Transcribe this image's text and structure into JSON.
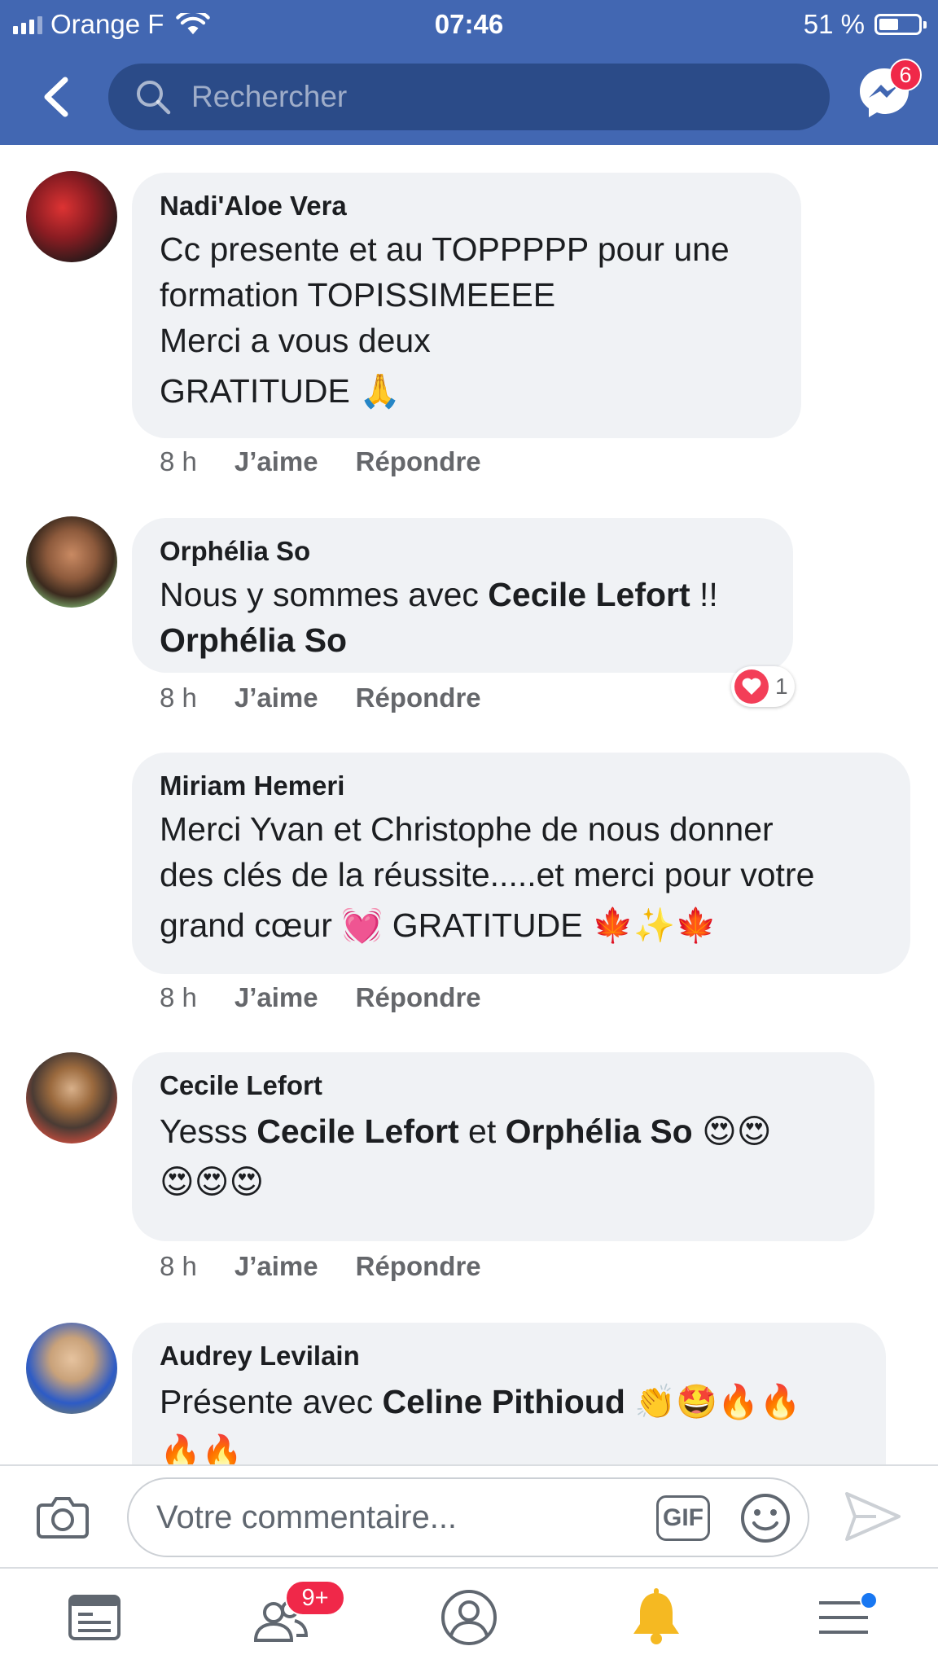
{
  "status_bar": {
    "carrier": "Orange F",
    "time": "07:46",
    "battery": "51 %",
    "battery_level": 0.51
  },
  "header": {
    "search_placeholder": "Rechercher",
    "messenger_badge": "6"
  },
  "comments": [
    {
      "author": "Nadi'Aloe Vera",
      "lines": [
        "Cc presente et au TOPPPPP pour une",
        "formation TOPISSIMEEEE",
        "Merci a vous deux",
        "GRATITUDE 🙏"
      ],
      "time": "8 h",
      "like": "J’aime",
      "reply": "Répondre"
    },
    {
      "author": "Orphélia So",
      "text_parts": [
        "Nous y sommes avec ",
        "Cecile Lefort",
        " !!",
        "Orphélia So"
      ],
      "time": "8 h",
      "like": "J’aime",
      "reply": "Répondre",
      "reaction_count": "1"
    },
    {
      "author": "Miriam Hemeri",
      "lines": [
        "Merci Yvan et Christophe de nous donner",
        "des clés de la réussite.....et merci pour votre",
        "grand cœur 💓 GRATITUDE 🍁✨🍁"
      ],
      "time": "8 h",
      "like": "J’aime",
      "reply": "Répondre"
    },
    {
      "author": "Cecile Lefort",
      "text_parts": [
        "Yesss ",
        "Cecile Lefort",
        " et ",
        "Orphélia So",
        " 😍😍",
        "😍😍😍"
      ],
      "time": "8 h",
      "like": "J’aime",
      "reply": "Répondre"
    },
    {
      "author": "Audrey Levilain",
      "text_parts": [
        "Présente avec ",
        "Celine Pithioud",
        " 👏🤩🔥🔥",
        "🔥🔥"
      ]
    }
  ],
  "composer": {
    "placeholder": "Votre commentaire...",
    "gif_label": "GIF"
  },
  "tabbar": {
    "friends_badge": "9+"
  },
  "colors": {
    "header_blue": "#4267b2",
    "search_bg": "#2b4b88",
    "bubble_bg": "#f0f2f5",
    "badge_red": "#f02849",
    "meta_gray": "#65676b"
  }
}
